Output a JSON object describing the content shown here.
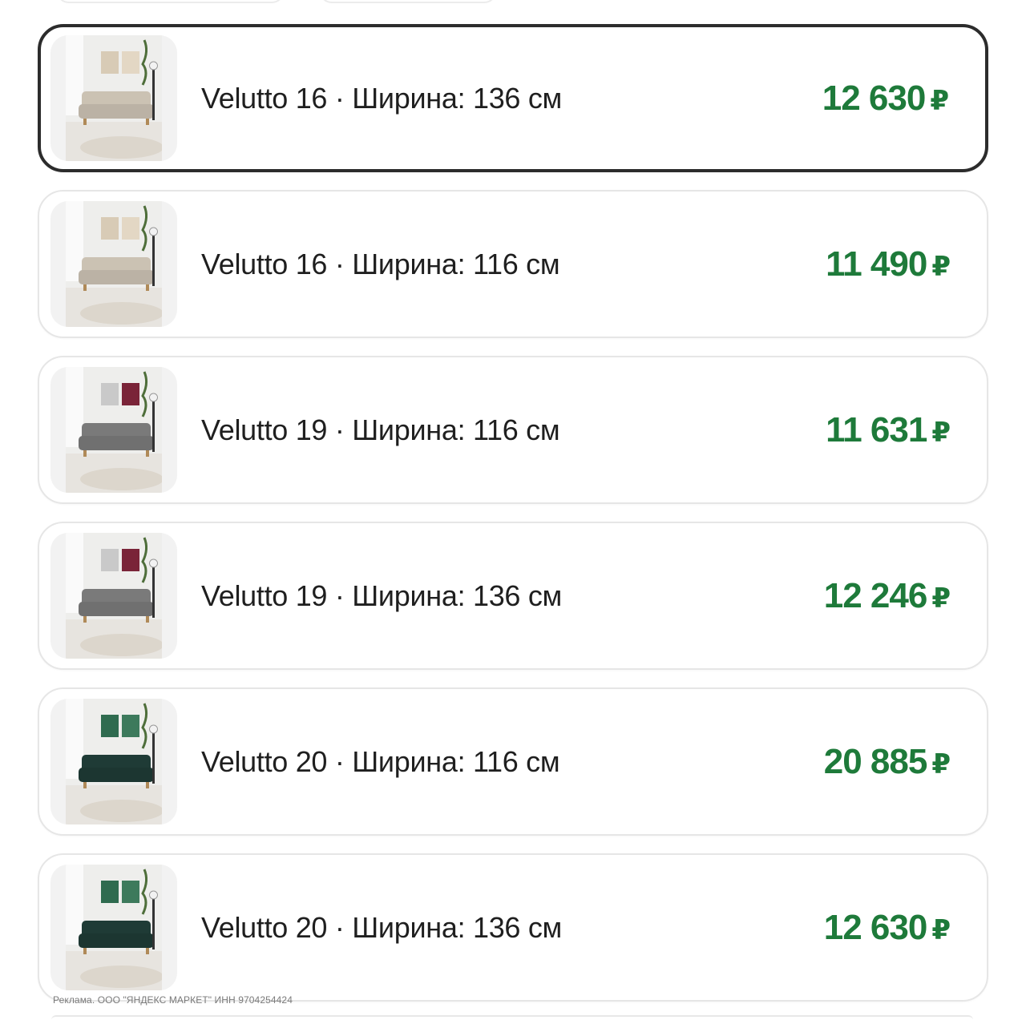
{
  "items": [
    {
      "title": "Velutto 16 · Ширина: 136 см",
      "price": "12 630",
      "currency": "₽",
      "selected": true,
      "sofa_color": "#cbc2b3",
      "art": "beige"
    },
    {
      "title": "Velutto 16 · Ширина: 116 см",
      "price": "11 490",
      "currency": "₽",
      "selected": false,
      "sofa_color": "#cbc2b3",
      "art": "beige"
    },
    {
      "title": "Velutto 19 · Ширина: 116 см",
      "price": "11 631",
      "currency": "₽",
      "selected": false,
      "sofa_color": "#7a7a7a",
      "art": "grey"
    },
    {
      "title": "Velutto 19 · Ширина: 136 см",
      "price": "12 246",
      "currency": "₽",
      "selected": false,
      "sofa_color": "#7a7a7a",
      "art": "grey"
    },
    {
      "title": "Velutto 20 · Ширина: 116 см",
      "price": "20 885",
      "currency": "₽",
      "selected": false,
      "sofa_color": "#1f3b36",
      "art": "green"
    },
    {
      "title": "Velutto 20 · Ширина: 136 см",
      "price": "12 630",
      "currency": "₽",
      "selected": false,
      "sofa_color": "#1f3b36",
      "art": "green"
    }
  ],
  "ad_disclaimer": "Реклама. ООО \"ЯНДЕКС МАРКЕТ\" ИНН 9704254424",
  "colors": {
    "price": "#1e7a3a",
    "selected_border": "#2c2c2c",
    "card_border": "#e6e6e6"
  }
}
